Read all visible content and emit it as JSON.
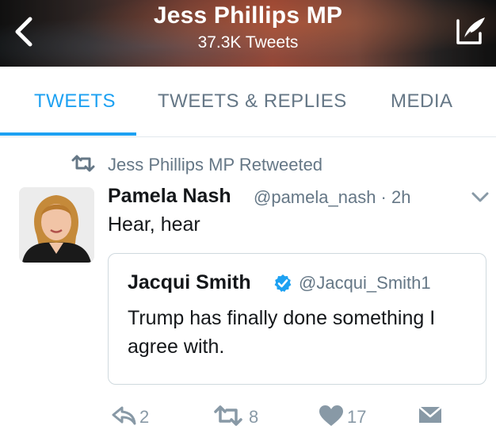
{
  "header": {
    "title": "Jess Phillips MP",
    "subtitle": "37.3K Tweets",
    "icons": {
      "back": "chevron-left-icon",
      "compose": "compose-tweet-icon"
    }
  },
  "tabs": [
    {
      "label": "TWEETS",
      "active": true
    },
    {
      "label": "TWEETS & REPLIES",
      "active": false
    },
    {
      "label": "MEDIA",
      "active": false
    }
  ],
  "tweet": {
    "retweet_context": "Jess Phillips MP Retweeted",
    "author_name": "Pamela Nash",
    "author_meta": "@pamela_nash · 2h",
    "text": "Hear, hear",
    "quoted": {
      "name": "Jacqui Smith",
      "handle": "@Jacqui_Smith1",
      "text": "Trump has finally done something I agree with."
    },
    "actions": {
      "reply_count": "2",
      "retweet_count": "8",
      "like_count": "17"
    }
  },
  "colors": {
    "accent": "#1da1f2",
    "secondary_text": "#657786",
    "icon_gray": "#8899a6",
    "primary_text": "#14171a"
  }
}
